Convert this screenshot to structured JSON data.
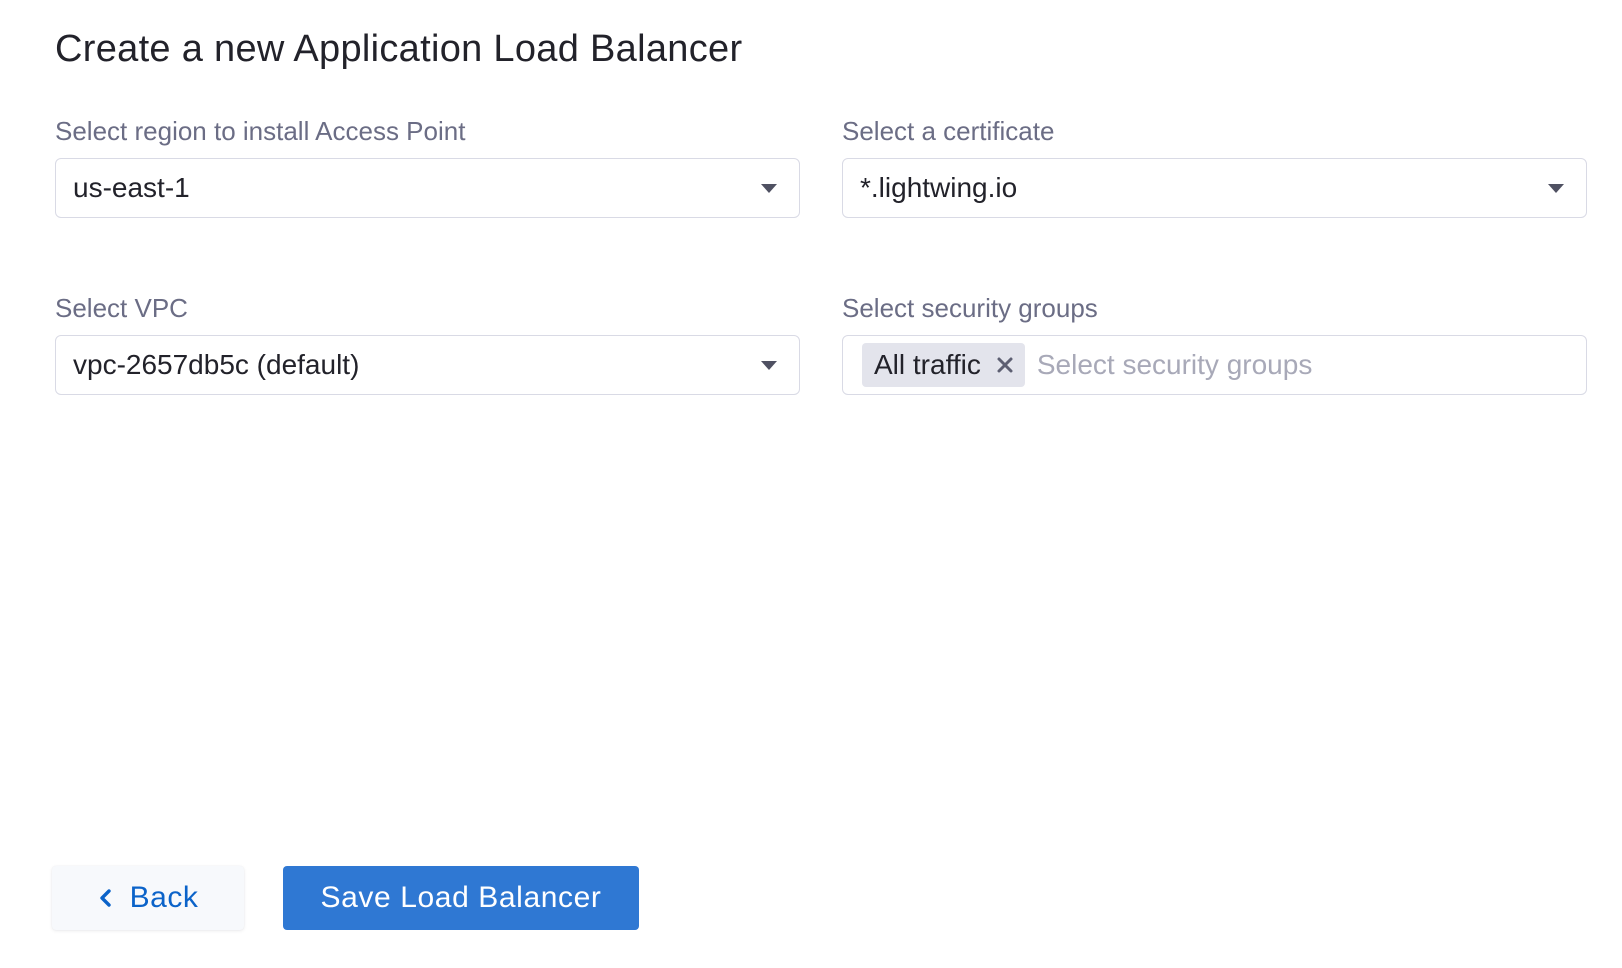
{
  "page": {
    "title": "Create a new Application Load Balancer"
  },
  "form": {
    "region": {
      "label": "Select region to install Access Point",
      "value": "us-east-1"
    },
    "certificate": {
      "label": "Select a certificate",
      "value": "*.lightwing.io"
    },
    "vpc": {
      "label": "Select VPC",
      "value": "vpc-2657db5c (default)"
    },
    "security_groups": {
      "label": "Select security groups",
      "selected": [
        "All traffic"
      ],
      "placeholder": "Select security groups"
    }
  },
  "actions": {
    "back_label": "Back",
    "save_label": "Save Load Balancer"
  },
  "icons": {
    "dropdown": "caret-down-icon",
    "remove_tag": "close-icon",
    "back": "chevron-left-icon"
  },
  "colors": {
    "primary": "#2f78d3",
    "link": "#0b63c9",
    "label": "#6b6d85",
    "border": "#d9dae5",
    "tag_bg": "#e3e4ec"
  }
}
